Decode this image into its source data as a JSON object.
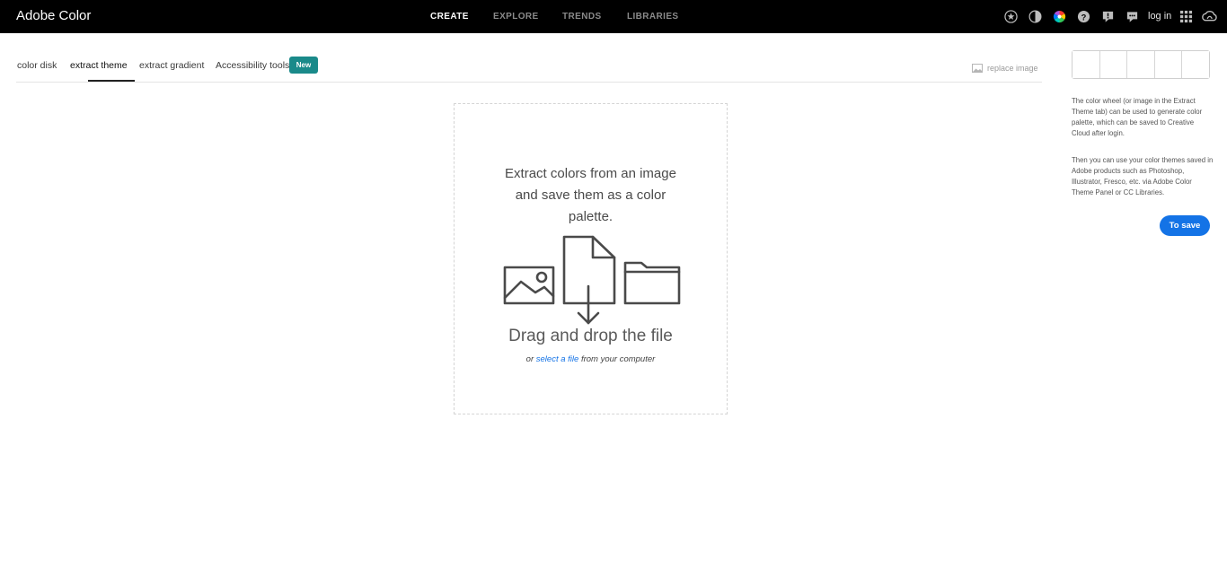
{
  "app": {
    "title": "Adobe Color"
  },
  "nav": {
    "create": "CREATE",
    "explore": "EXPLORE",
    "trends": "TRENDS",
    "libraries": "LIBRARIES"
  },
  "header": {
    "icons": [
      "star-icon",
      "contrast-icon",
      "color-wheel-icon",
      "help-icon",
      "feedback-icon",
      "chat-icon",
      "apps-grid-icon",
      "creative-cloud-icon"
    ],
    "login": "log in"
  },
  "tabs": {
    "color_disk": "color disk",
    "extract_theme": "extract theme",
    "extract_gradient": "extract gradient",
    "accessibility": "Accessibility tools",
    "new_badge": "New",
    "active": "extract theme"
  },
  "replace_image": "replace image",
  "dropzone": {
    "line1": "Extract colors from an image",
    "line2": "and save them as a color",
    "line3": "palette.",
    "drag": "Drag and drop the file",
    "sub_prefix": "or",
    "select_link": "select a file",
    "sub_suffix": "from your computer"
  },
  "sidebar": {
    "swatches": [
      "#ffffff",
      "#ffffff",
      "#ffffff",
      "#ffffff",
      "#ffffff"
    ],
    "info1": "The color wheel (or image in the Extract Theme tab) can be used to generate color palette, which can be saved to Creative Cloud after login.",
    "info2": "Then you can use your color themes saved in Adobe products such as Photoshop, Illustrator, Fresco, etc. via Adobe Color Theme Panel or CC Libraries.",
    "save_button": "To save"
  },
  "colors": {
    "topbar": "#000000",
    "accent": "#1473e6",
    "badge": "#1a8a8a"
  }
}
